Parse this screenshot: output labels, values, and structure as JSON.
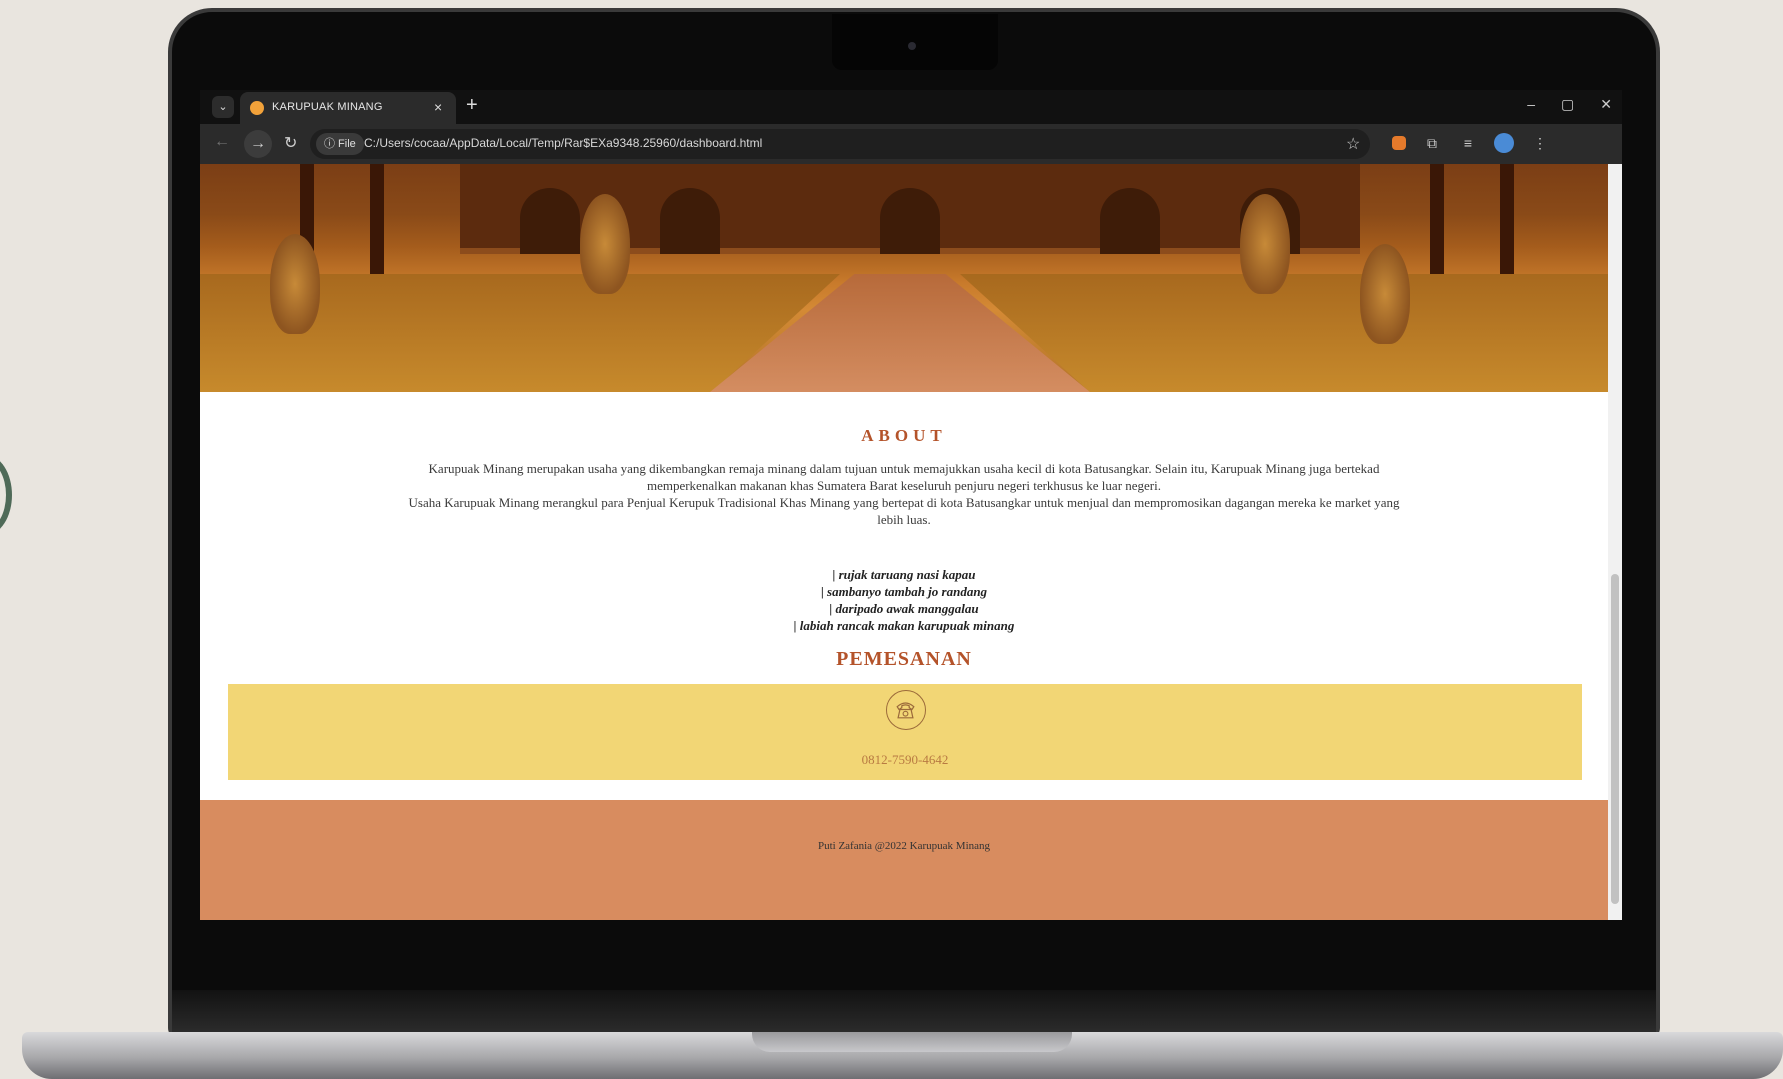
{
  "browser": {
    "tab_title": "KARUPUAK MINANG",
    "tab_close": "×",
    "new_tab": "+",
    "file_chip": "ⓘ File",
    "url": "C:/Users/cocaa/AppData/Local/Temp/Rar$EXa9348.25960/dashboard.html",
    "window_controls": [
      "–",
      "▢",
      "✕"
    ]
  },
  "about": {
    "heading": "ABOUT",
    "paragraph_1": "Karupuak Minang merupakan usaha yang dikembangkan remaja minang dalam tujuan untuk memajukkan usaha kecil di kota Batusangkar. Selain itu, Karupuak Minang juga bertekad memperkenalkan makanan khas Sumatera Barat keseluruh penjuru negeri terkhusus ke luar negeri.",
    "paragraph_2": "Usaha Karupuak Minang merangkul para Penjual Kerupuk Tradisional Khas Minang yang bertepat di kota Batusangkar untuk menjual dan mempromosikan dagangan mereka ke market yang lebih luas."
  },
  "pantun": [
    "| rujak taruang nasi kapau",
    "| sambanyo tambah jo randang",
    "| daripado awak manggalau",
    "| labiah rancak makan karupuak minang"
  ],
  "order": {
    "heading": "PEMESANAN",
    "phone": "0812-7590-4642"
  },
  "footer": {
    "text": "Puti Zafania @2022 Karupuak Minang"
  }
}
